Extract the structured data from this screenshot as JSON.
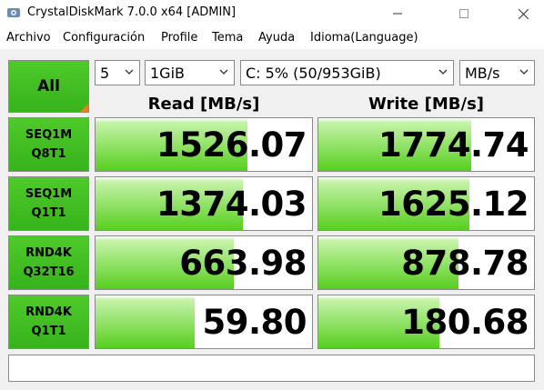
{
  "window": {
    "title": "CrystalDiskMark 7.0.0 x64 [ADMIN]"
  },
  "menu": [
    "Archivo",
    "Configuración",
    "Profile",
    "Tema",
    "Ayuda",
    "Idioma(Language)"
  ],
  "controls": {
    "all_label": "All",
    "count": "5",
    "size": "1GiB",
    "drive": "C: 5% (50/953GiB)",
    "unit": "MB/s"
  },
  "headers": {
    "read": "Read [MB/s]",
    "write": "Write [MB/s]"
  },
  "tests": [
    {
      "line1": "SEQ1M",
      "line2": "Q8T1",
      "read": "1526.07",
      "write": "1774.74",
      "read_fill": 0.7,
      "write_fill": 0.71
    },
    {
      "line1": "SEQ1M",
      "line2": "Q1T1",
      "read": "1374.03",
      "write": "1625.12",
      "read_fill": 0.68,
      "write_fill": 0.7
    },
    {
      "line1": "RND4K",
      "line2": "Q32T16",
      "read": "663.98",
      "write": "878.78",
      "read_fill": 0.64,
      "write_fill": 0.65
    },
    {
      "line1": "RND4K",
      "line2": "Q1T1",
      "read": "59.80",
      "write": "180.68",
      "read_fill": 0.46,
      "write_fill": 0.56
    }
  ],
  "comment": "",
  "colors": {
    "button_green": "#3cb81f",
    "bar_green": "#57cf1f",
    "accent_orange": "#e67e22"
  }
}
